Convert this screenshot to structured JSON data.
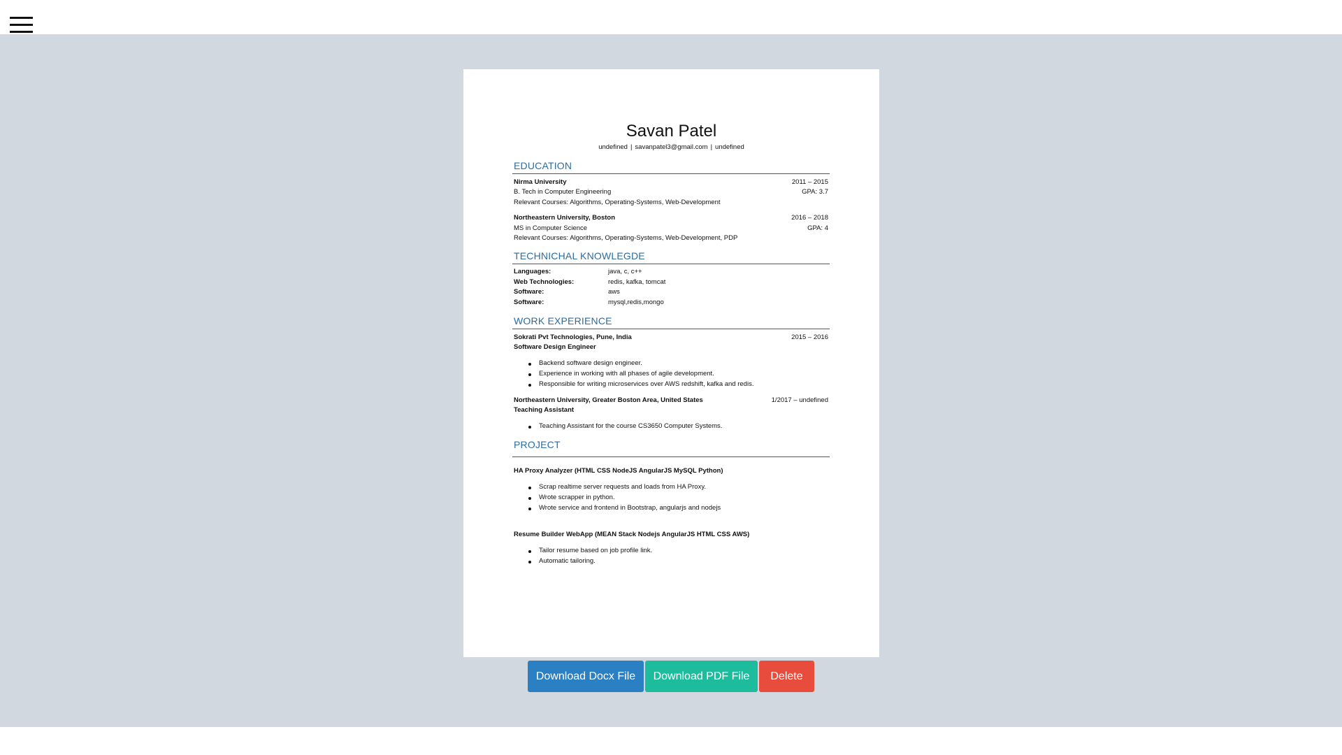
{
  "resume": {
    "name": "Savan Patel",
    "contact": {
      "phone": "undefined",
      "email": "savanpatel3@gmail.com",
      "link": "undefined",
      "separator": "|"
    },
    "education": {
      "title": "EDUCATION",
      "items": [
        {
          "school": "Nirma University",
          "dates": "2011 – 2015",
          "degree": "B. Tech in Computer Engineering",
          "gpa": "GPA: 3.7",
          "courses": "Relevant Courses: Algorithms, Operating-Systems, Web-Development"
        },
        {
          "school": "Northeastern University, Boston",
          "dates": "2016 – 2018",
          "degree": "MS in Computer Science",
          "gpa": "GPA: 4",
          "courses": "Relevant Courses: Algorithms, Operating-Systems, Web-Development, PDP"
        }
      ]
    },
    "knowledge": {
      "title": "TECHNICHAL KNOWLEGDE",
      "items": [
        {
          "label": "Languages:",
          "value": "java, c, c++"
        },
        {
          "label": "Web Technologies:",
          "value": "redis, kafka, tomcat"
        },
        {
          "label": "Software:",
          "value": "aws"
        },
        {
          "label": "Software:",
          "value": "mysql,redis,mongo"
        }
      ]
    },
    "work": {
      "title": "WORK EXPERIENCE",
      "items": [
        {
          "company": "Sokrati Pvt Technologies, Pune, India",
          "dates": "2015 – 2016",
          "role": "Software Design Engineer",
          "bullets": [
            "Backend software design engineer.",
            "Experience in working with all phases of agile development.",
            "Responsible for writing microservices over AWS redshift, kafka and redis."
          ]
        },
        {
          "company": "Northeastern University, Greater Boston Area, United States",
          "dates": "1/2017 – undefined",
          "role": "Teaching Assistant",
          "bullets": [
            "Teaching Assistant for the course CS3650 Computer Systems."
          ]
        }
      ]
    },
    "projects": {
      "title": "PROJECT",
      "items": [
        {
          "name": "HA Proxy Analyzer (HTML CSS NodeJS AngularJS MySQL Python)",
          "bullets": [
            "Scrap realtime server requests and loads from HA Proxy.",
            "Wrote scrapper in python.",
            "Wrote service and frontend in Bootstrap, angularjs and nodejs"
          ]
        },
        {
          "name": "Resume Builder WebApp (MEAN Stack Nodejs AngularJS HTML CSS AWS)",
          "bullets": [
            "Tailor resume based on job profile link.",
            "Automatic tailoring."
          ]
        }
      ]
    }
  },
  "actions": {
    "download_docx": "Download Docx File",
    "download_pdf": "Download PDF File",
    "delete": "Delete"
  },
  "icons": {
    "menu": "hamburger-menu-icon"
  },
  "colors": {
    "section_title": "#2b6ca3",
    "stage_bg": "#d1d8e0",
    "docx_button": "#2b80c3",
    "pdf_button": "#1cbc9c",
    "delete_button": "#e74c3c"
  }
}
